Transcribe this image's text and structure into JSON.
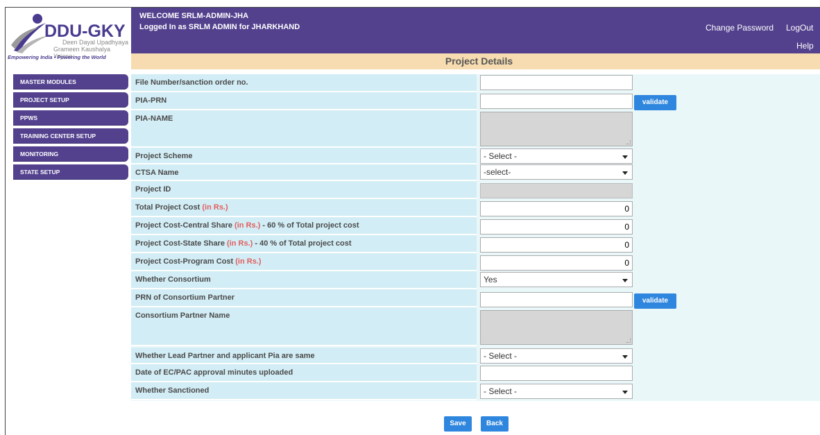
{
  "logo": {
    "title": "DDU-GKY",
    "sub1": "Deen Dayal Upadhyaya",
    "sub2": "Grameen Kaushalya Yojana",
    "tagline": "Empowering India • Powering the World"
  },
  "header": {
    "welcome": "WELCOME  SRLM-ADMIN-JHA",
    "logged_in": "Logged In as  SRLM ADMIN for JHARKHAND",
    "change_password": "Change Password",
    "logout": "LogOut",
    "help": "Help",
    "bg_color": "#53418e"
  },
  "page_title": "Project Details",
  "sidebar": {
    "items": [
      {
        "label": "MASTER MODULES"
      },
      {
        "label": "PROJECT SETUP"
      },
      {
        "label": "PPWS"
      },
      {
        "label": "TRAINING CENTER SETUP"
      },
      {
        "label": "MONITORING"
      },
      {
        "label": "STATE SETUP"
      }
    ]
  },
  "form": {
    "file_number": {
      "label": "File Number/sanction order no.",
      "value": ""
    },
    "pia_prn": {
      "label": "PIA-PRN",
      "value": "",
      "validate": "validate"
    },
    "pia_name": {
      "label": "PIA-NAME",
      "value": ""
    },
    "project_scheme": {
      "label": "Project Scheme",
      "value": "- Select -"
    },
    "ctsa_name": {
      "label": "CTSA Name",
      "value": "-select-"
    },
    "project_id": {
      "label": "Project ID",
      "value": ""
    },
    "total_cost": {
      "label": "Total Project Cost",
      "unit": "(in Rs.)",
      "value": "0"
    },
    "central_share": {
      "label": "Project Cost-Central Share",
      "unit": "(in Rs.)",
      "suffix": " - 60 % of Total project cost",
      "value": "0"
    },
    "state_share": {
      "label": "Project Cost-State Share",
      "unit": "(in Rs.)",
      "suffix": " - 40 % of Total project cost",
      "value": "0"
    },
    "program_cost": {
      "label": "Project Cost-Program Cost",
      "unit": "(in Rs.)",
      "value": "0"
    },
    "consortium": {
      "label": "Whether Consortium",
      "value": "Yes"
    },
    "consortium_prn": {
      "label": "PRN of Consortium Partner",
      "value": "",
      "validate": "validate"
    },
    "consortium_name": {
      "label": "Consortium Partner Name",
      "value": ""
    },
    "lead_partner_same": {
      "label": "Whether Lead Partner and applicant Pia are same",
      "value": "- Select -"
    },
    "ec_pac_date": {
      "label": "Date of EC/PAC approval minutes uploaded",
      "value": ""
    },
    "sanctioned": {
      "label": "Whether Sanctioned",
      "value": "- Select -"
    }
  },
  "buttons": {
    "save": "Save",
    "back": "Back"
  }
}
